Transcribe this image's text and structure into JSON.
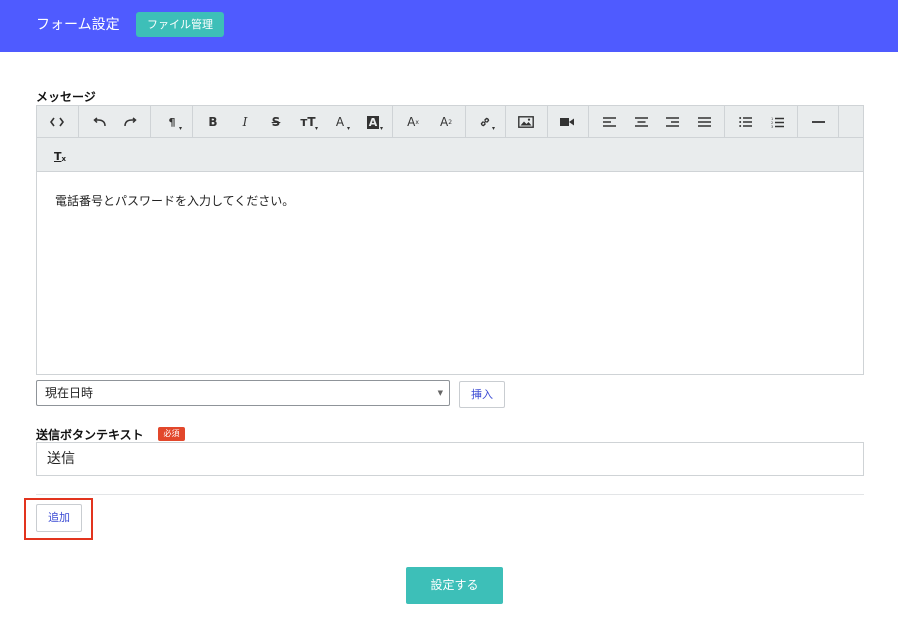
{
  "header": {
    "title": "フォーム設定",
    "file_button": "ファイル管理",
    "bg_color": "#4f5bff",
    "accent_color": "#3dbfb8"
  },
  "message": {
    "label": "メッセージ",
    "toolbar": {
      "code": "<>",
      "undo": "↶",
      "redo": "↷",
      "paragraph": "¶",
      "bold": "B",
      "italic": "I",
      "strike": "S",
      "font_size": "тT",
      "font_color": "A",
      "bg_color": "A",
      "superscript": "A",
      "superscript_mark": "x",
      "subscript": "A",
      "subscript_mark": "2",
      "clear_format": "Tx"
    },
    "body": "電話番号とパスワードを入力してください。"
  },
  "insert_select": {
    "selected": "現在日時",
    "button": "挿入"
  },
  "send_button_text": {
    "label": "送信ボタンテキスト",
    "required": "必須",
    "value": "送信"
  },
  "add_button": "追加",
  "submit_button": "設定する",
  "icons": [
    "code-icon",
    "undo-icon",
    "redo-icon",
    "paragraph-icon",
    "bold-icon",
    "italic-icon",
    "strikethrough-icon",
    "font-size-icon",
    "font-color-icon",
    "background-color-icon",
    "superscript-icon",
    "subscript-icon",
    "link-icon",
    "image-icon",
    "video-icon",
    "align-left-icon",
    "align-center-icon",
    "align-right-icon",
    "align-justify-icon",
    "bullet-list-icon",
    "numbered-list-icon",
    "horizontal-rule-icon",
    "clear-format-icon"
  ]
}
